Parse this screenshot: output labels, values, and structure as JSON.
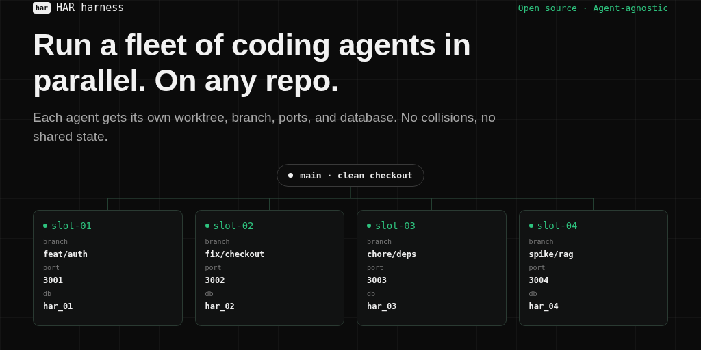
{
  "header": {
    "logo": "har",
    "brand": "HAR harness",
    "tagline": "Open source · Agent-agnostic"
  },
  "hero": {
    "title": "Run a fleet of coding agents in parallel. On any repo.",
    "subtitle": "Each agent gets its own worktree, branch, ports, and database. No collisions, no shared state."
  },
  "root": {
    "label": "main · clean checkout"
  },
  "slots": [
    {
      "name": "slot-01",
      "fields": [
        {
          "label": "branch",
          "value": "feat/auth"
        },
        {
          "label": "port",
          "value": "3001"
        },
        {
          "label": "db",
          "value": "har_01"
        }
      ]
    },
    {
      "name": "slot-02",
      "fields": [
        {
          "label": "branch",
          "value": "fix/checkout"
        },
        {
          "label": "port",
          "value": "3002"
        },
        {
          "label": "db",
          "value": "har_02"
        }
      ]
    },
    {
      "name": "slot-03",
      "fields": [
        {
          "label": "branch",
          "value": "chore/deps"
        },
        {
          "label": "port",
          "value": "3003"
        },
        {
          "label": "db",
          "value": "har_03"
        }
      ]
    },
    {
      "name": "slot-04",
      "fields": [
        {
          "label": "branch",
          "value": "spike/rag"
        },
        {
          "label": "port",
          "value": "3004"
        },
        {
          "label": "db",
          "value": "har_04"
        }
      ]
    }
  ]
}
